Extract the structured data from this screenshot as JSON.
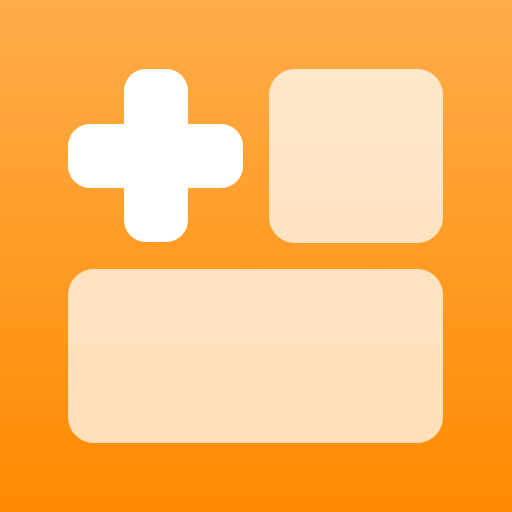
{
  "icon": {
    "name": "widget-add",
    "glyph": "plus-icon",
    "tiles": [
      "square-tile",
      "wide-tile"
    ],
    "colors": {
      "background_top": "#FFAD4A",
      "background_bottom": "#FF8A00",
      "plus": "#FFFFFF",
      "tile": "#FFE2C2"
    }
  }
}
